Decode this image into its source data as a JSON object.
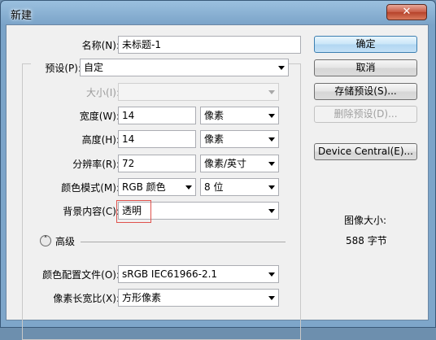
{
  "window": {
    "title": "新建",
    "close_glyph": "✕"
  },
  "form": {
    "name_label": "名称(N):",
    "name_value": "未标题-1",
    "preset_label": "预设(P):",
    "preset_value": "自定",
    "size_label": "大小(I):",
    "size_value": "",
    "width_label": "宽度(W):",
    "width_value": "14",
    "width_unit": "像素",
    "height_label": "高度(H):",
    "height_value": "14",
    "height_unit": "像素",
    "resolution_label": "分辨率(R):",
    "resolution_value": "72",
    "resolution_unit": "像素/英寸",
    "color_mode_label": "颜色模式(M):",
    "color_mode_value": "RGB 颜色",
    "bit_depth_value": "8 位",
    "background_label": "背景内容(C):",
    "background_value": "透明",
    "advanced_label": "高级",
    "advanced_toggle_glyph": "˄",
    "color_profile_label": "颜色配置文件(O):",
    "color_profile_value": "sRGB IEC61966-2.1",
    "pixel_aspect_label": "像素长宽比(X):",
    "pixel_aspect_value": "方形像素"
  },
  "buttons": {
    "ok": "确定",
    "cancel": "取消",
    "save_preset": "存储预设(S)...",
    "delete_preset": "删除预设(D)...",
    "device_central": "Device Central(E)..."
  },
  "info": {
    "image_size_label": "图像大小:",
    "image_size_value": "588 字节"
  }
}
